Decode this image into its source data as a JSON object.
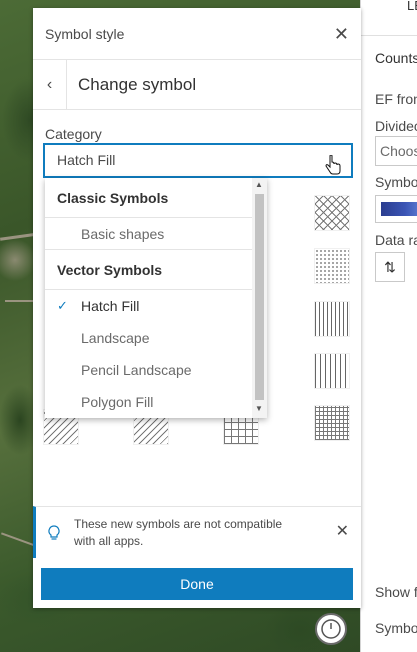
{
  "panel": {
    "title": "Symbol style",
    "subtitle": "Change symbol",
    "category_label": "Category",
    "category_value": "Hatch Fill"
  },
  "dropdown": {
    "groups": [
      {
        "label": "Classic Symbols",
        "items": [
          "Basic shapes"
        ]
      },
      {
        "label": "Vector Symbols",
        "items": [
          "Hatch Fill",
          "Landscape",
          "Pencil Landscape",
          "Polygon Fill"
        ]
      }
    ],
    "selected": "Hatch Fill"
  },
  "notice": {
    "text": "These new symbols are not compatible with all apps."
  },
  "done_label": "Done",
  "right_panel": {
    "tab_fragment": "LE",
    "heading_fragment": "Counts",
    "ef_fragment": "EF fron",
    "divided_fragment": "Dividec",
    "choose_fragment": "Choos",
    "symbol_fragment": "Symbo",
    "data_range_fragment": "Data ra",
    "show_fragment": "Show f",
    "symbol2_fragment": "Symbo"
  },
  "icons": [
    "close-icon",
    "back-chevron-icon",
    "check-icon",
    "lightbulb-icon",
    "swap-icon",
    "clock-icon",
    "cursor-icon"
  ],
  "colors": {
    "accent": "#0f7cbe"
  }
}
